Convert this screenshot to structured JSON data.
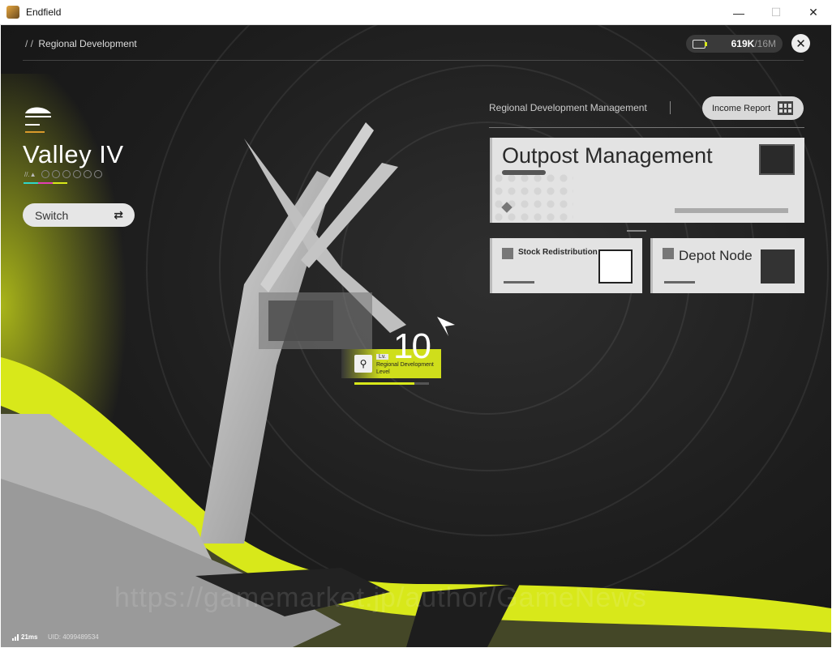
{
  "window": {
    "title": "Endfield",
    "minimize_glyph": "—",
    "maximize_glyph": "☐",
    "close_glyph": "✕"
  },
  "header": {
    "breadcrumb_slashes": "/ /",
    "breadcrumb": "Regional Development",
    "currency_value": "619K",
    "currency_max": "/16M",
    "close_glyph": "✕"
  },
  "region": {
    "name": "Valley IV",
    "dots_prefix": "//.▲",
    "accent_colors": [
      "#2fd6c8",
      "#e23fb3",
      "#d8e81a"
    ]
  },
  "switch_button": {
    "label": "Switch",
    "icon_glyph": "⇄"
  },
  "level": {
    "lv_label": "Lv.",
    "value": "10",
    "description": "Regional Development Level",
    "search_glyph": "⚲",
    "progress_fraction": 0.8
  },
  "panel": {
    "title": "Regional Development Management",
    "income_button": "Income Report",
    "cards": {
      "outpost": {
        "title": "Outpost Management"
      },
      "stock": {
        "title": "Stock Redistribution"
      },
      "depot": {
        "title": "Depot Node"
      }
    }
  },
  "footer": {
    "ping": "21ms",
    "uid": "UID: 4099489534",
    "watermark": "https://gamemarket.jp/author/GameNews"
  },
  "colors": {
    "accent": "#d8e81a",
    "background": "#1d1d1d"
  }
}
